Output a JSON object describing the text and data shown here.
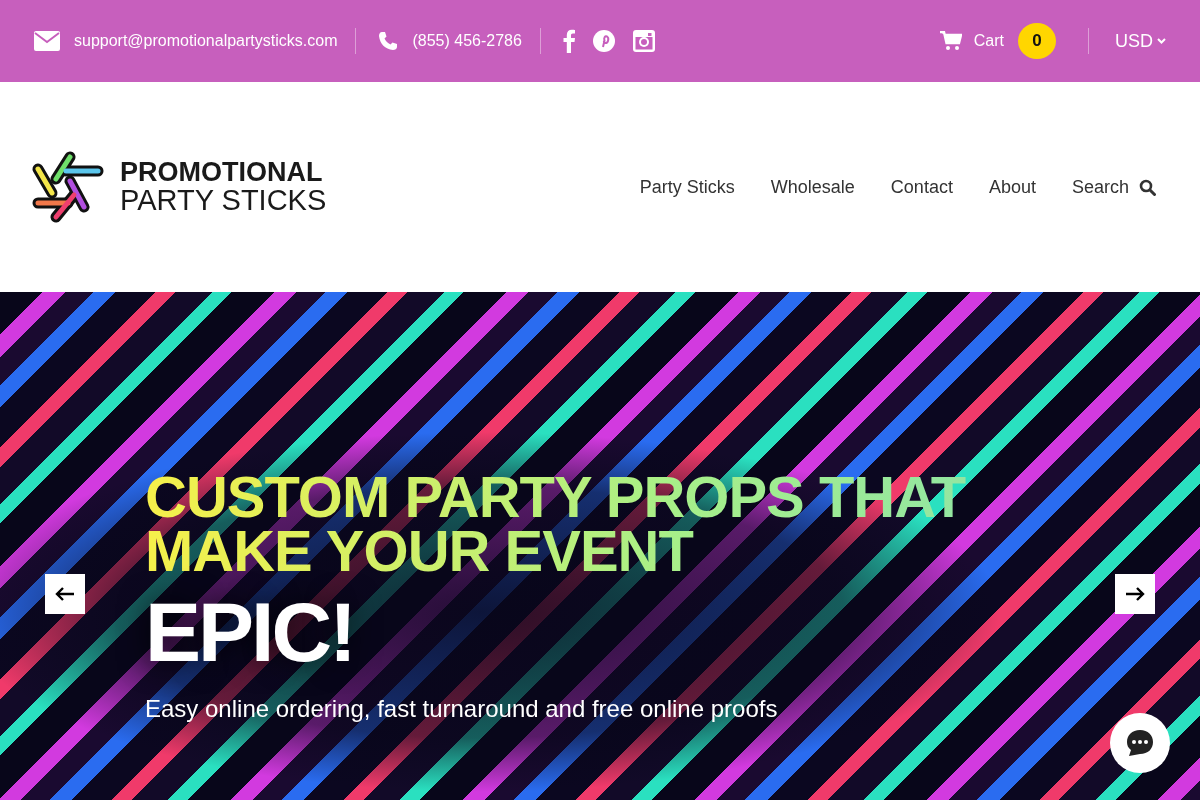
{
  "top_bar": {
    "email": "support@promotionalpartysticks.com",
    "phone": "(855) 456-2786",
    "cart_label": "Cart",
    "cart_count": "0",
    "currency": "USD"
  },
  "logo": {
    "line_1": "PROMOTIONAL",
    "line_2": "PARTY STICKS"
  },
  "nav": [
    "Party Sticks",
    "Wholesale",
    "Contact",
    "About",
    "Search"
  ],
  "hero": {
    "headline": "CUSTOM PARTY PROPS THAT MAKE YOUR EVENT",
    "headline_accent": "EPIC!",
    "subtitle": "Easy online ordering, fast turnaround and free online proofs"
  }
}
